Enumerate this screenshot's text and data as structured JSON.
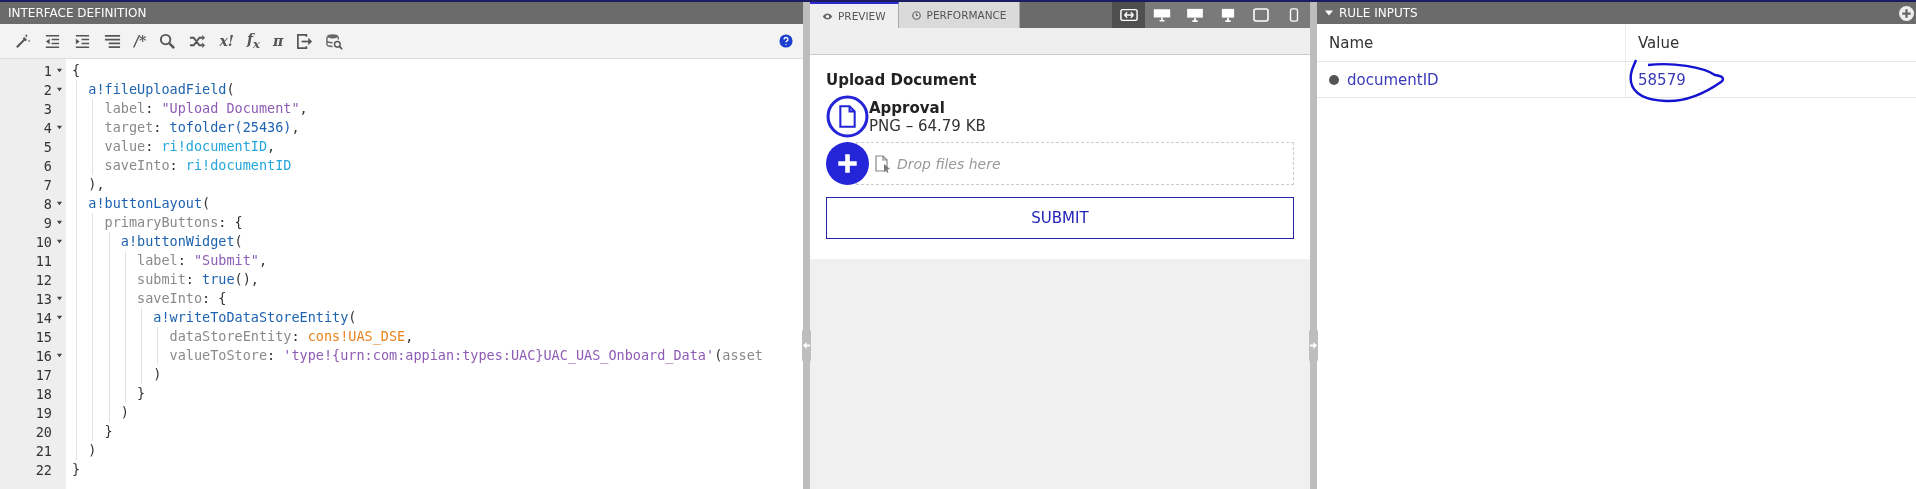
{
  "editor": {
    "title": "INTERFACE DEFINITION",
    "toolbar": [
      {
        "kind": "wand"
      },
      {
        "kind": "outdent"
      },
      {
        "kind": "indent"
      },
      {
        "kind": "list"
      },
      {
        "kind": "glyph",
        "label": "/*"
      },
      {
        "kind": "search"
      },
      {
        "kind": "shuffle"
      },
      {
        "kind": "glyph",
        "label": "x!"
      },
      {
        "kind": "glyph",
        "label": "f$_{x}$"
      },
      {
        "kind": "glyph",
        "label": "π"
      },
      {
        "kind": "export"
      },
      {
        "kind": "db-search"
      },
      {
        "kind": "help"
      }
    ],
    "lines": [
      {
        "number": "1",
        "foldable": true,
        "tokens": [
          {
            "kind": "p",
            "s": "{"
          }
        ]
      },
      {
        "number": "2",
        "foldable": true,
        "tokens": [
          {
            "kind": "fn",
            "s": "  a!fileUploadField"
          },
          {
            "kind": "p",
            "s": "("
          }
        ]
      },
      {
        "number": "3",
        "foldable": false,
        "tokens": [
          {
            "kind": "key",
            "s": "    label"
          },
          {
            "kind": "p",
            "s": ": "
          },
          {
            "kind": "str",
            "s": "\"Upload Document\""
          },
          {
            "kind": "p",
            "s": ","
          }
        ]
      },
      {
        "number": "4",
        "foldable": true,
        "tokens": [
          {
            "kind": "key",
            "s": "    target"
          },
          {
            "kind": "p",
            "s": ": "
          },
          {
            "kind": "fn",
            "s": "tofolder(25436)"
          },
          {
            "kind": "p",
            "s": ","
          }
        ]
      },
      {
        "number": "5",
        "foldable": false,
        "tokens": [
          {
            "kind": "key",
            "s": "    value"
          },
          {
            "kind": "p",
            "s": ": "
          },
          {
            "kind": "ri",
            "s": "ri!documentID"
          },
          {
            "kind": "p",
            "s": ","
          }
        ]
      },
      {
        "number": "6",
        "foldable": false,
        "tokens": [
          {
            "kind": "key",
            "s": "    saveInto"
          },
          {
            "kind": "p",
            "s": ": "
          },
          {
            "kind": "ri",
            "s": "ri!documentID"
          }
        ]
      },
      {
        "number": "7",
        "foldable": false,
        "tokens": [
          {
            "kind": "p",
            "s": "  ),"
          }
        ]
      },
      {
        "number": "8",
        "foldable": true,
        "tokens": [
          {
            "kind": "fn",
            "s": "  a!buttonLayout"
          },
          {
            "kind": "p",
            "s": "("
          }
        ]
      },
      {
        "number": "9",
        "foldable": true,
        "tokens": [
          {
            "kind": "key",
            "s": "    primaryButtons"
          },
          {
            "kind": "p",
            "s": ": {"
          }
        ]
      },
      {
        "number": "10",
        "foldable": true,
        "tokens": [
          {
            "kind": "fn",
            "s": "      a!buttonWidget"
          },
          {
            "kind": "p",
            "s": "("
          }
        ]
      },
      {
        "number": "11",
        "foldable": false,
        "tokens": [
          {
            "kind": "key",
            "s": "        label"
          },
          {
            "kind": "p",
            "s": ": "
          },
          {
            "kind": "str",
            "s": "\"Submit\""
          },
          {
            "kind": "p",
            "s": ","
          }
        ]
      },
      {
        "number": "12",
        "foldable": false,
        "tokens": [
          {
            "kind": "key",
            "s": "        submit"
          },
          {
            "kind": "p",
            "s": ": "
          },
          {
            "kind": "fn",
            "s": "true"
          },
          {
            "kind": "p",
            "s": "(),"
          }
        ]
      },
      {
        "number": "13",
        "foldable": true,
        "tokens": [
          {
            "kind": "key",
            "s": "        saveInto"
          },
          {
            "kind": "p",
            "s": ": {"
          }
        ]
      },
      {
        "number": "14",
        "foldable": true,
        "tokens": [
          {
            "kind": "fn",
            "s": "          a!writeToDataStoreEntity"
          },
          {
            "kind": "p",
            "s": "("
          }
        ]
      },
      {
        "number": "15",
        "foldable": false,
        "tokens": [
          {
            "kind": "key",
            "s": "            dataStoreEntity"
          },
          {
            "kind": "p",
            "s": ": "
          },
          {
            "kind": "cons",
            "s": "cons!UAS_DSE"
          },
          {
            "kind": "p",
            "s": ","
          }
        ]
      },
      {
        "number": "16",
        "foldable": true,
        "tokens": [
          {
            "kind": "key",
            "s": "            valueToStore"
          },
          {
            "kind": "p",
            "s": ": "
          },
          {
            "kind": "str",
            "s": "'type!{urn:com:appian:types:UAC}UAC_UAS_Onboard_Data'"
          },
          {
            "kind": "p",
            "s": "("
          },
          {
            "kind": "key",
            "s": "asset"
          }
        ]
      },
      {
        "number": "17",
        "foldable": false,
        "tokens": [
          {
            "kind": "p",
            "s": "          )"
          }
        ]
      },
      {
        "number": "18",
        "foldable": false,
        "tokens": [
          {
            "kind": "p",
            "s": "        }"
          }
        ]
      },
      {
        "number": "19",
        "foldable": false,
        "tokens": [
          {
            "kind": "p",
            "s": "      )"
          }
        ]
      },
      {
        "number": "20",
        "foldable": false,
        "tokens": [
          {
            "kind": "p",
            "s": "    }"
          }
        ]
      },
      {
        "number": "21",
        "foldable": false,
        "tokens": [
          {
            "kind": "p",
            "s": "  )"
          }
        ]
      },
      {
        "number": "22",
        "foldable": false,
        "tokens": [
          {
            "kind": "p",
            "s": "}"
          }
        ]
      }
    ]
  },
  "preview": {
    "tabs": [
      {
        "label": "PREVIEW",
        "kind": "eye",
        "selected": true
      },
      {
        "label": "PERFORMANCE",
        "kind": "clock",
        "selected": false
      }
    ],
    "devices": [
      {
        "kind": "fit",
        "selected": true
      },
      {
        "kind": "wide",
        "selected": false
      },
      {
        "kind": "desktop",
        "selected": false
      },
      {
        "kind": "monitor",
        "selected": false
      },
      {
        "kind": "tablet",
        "selected": false
      },
      {
        "kind": "phone",
        "selected": false
      }
    ],
    "form": {
      "label": "Upload Document",
      "file_name": "Approval",
      "file_info": "PNG – 64.79 KB",
      "drop_hint": "Drop files here",
      "button": "SUBMIT"
    }
  },
  "rule_inputs": {
    "title": "RULE INPUTS",
    "columns": [
      "Name",
      "Value"
    ],
    "rows": [
      {
        "name": "documentID",
        "value": "58579",
        "circled": true
      }
    ]
  }
}
